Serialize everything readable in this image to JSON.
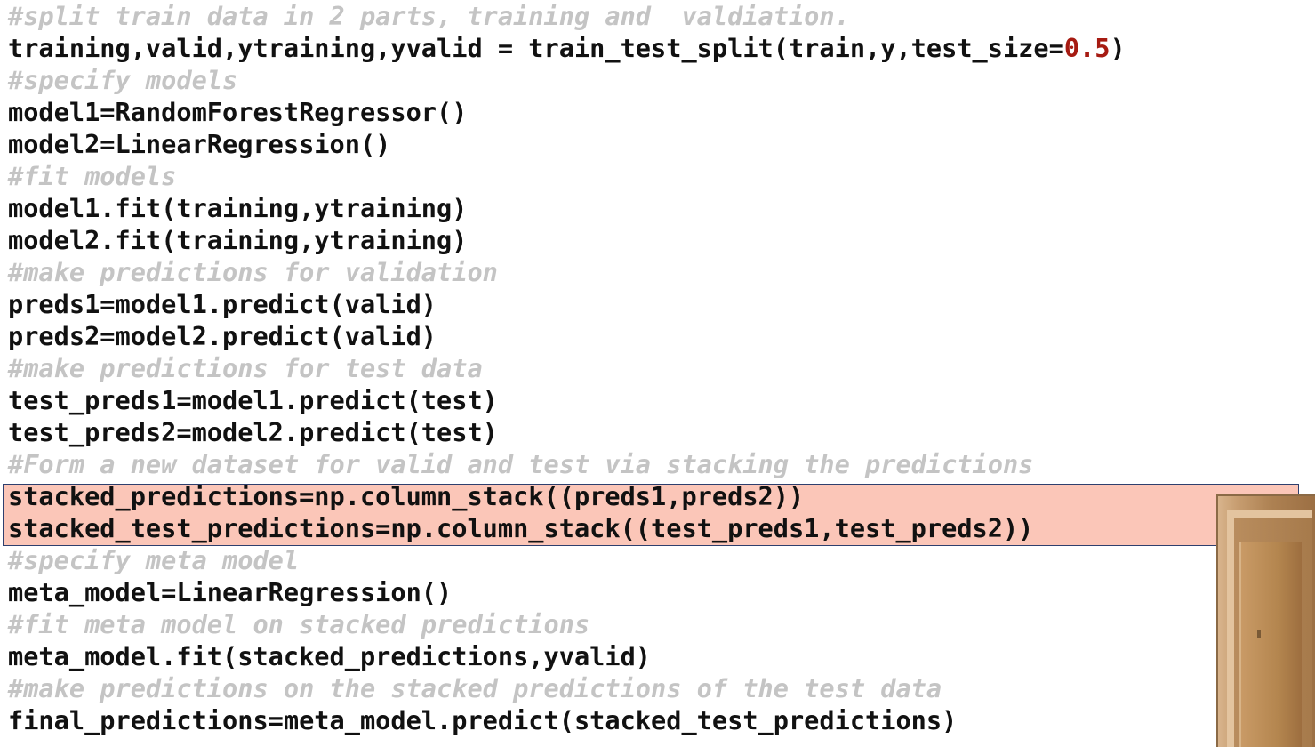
{
  "code": {
    "line_01": "#split train data in 2 parts, training and  valdiation.",
    "line_02_pre": "training,valid,ytraining,yvalid = train_test_split(train,y,test_size=",
    "line_02_num": "0.5",
    "line_02_post": ")",
    "line_03": "#specify models",
    "line_04": "model1=RandomForestRegressor()",
    "line_05": "model2=LinearRegression()",
    "line_06": "#fit models",
    "line_07": "model1.fit(training,ytraining)",
    "line_08": "model2.fit(training,ytraining)",
    "line_09": "#make predictions for validation",
    "line_10": "preds1=model1.predict(valid)",
    "line_11": "preds2=model2.predict(valid)",
    "line_12": "#make predictions for test data",
    "line_13": "test_preds1=model1.predict(test)",
    "line_14": "test_preds2=model2.predict(test)",
    "line_15": "#Form a new dataset for valid and test via stacking the predictions",
    "line_16": "stacked_predictions=np.column_stack((preds1,preds2))",
    "line_17": "stacked_test_predictions=np.column_stack((test_preds1,test_preds2))",
    "line_18": "#specify meta model",
    "line_19": "meta_model=LinearRegression()",
    "line_20": "#fit meta model on stacked predictions",
    "line_21": "meta_model.fit(stacked_predictions,yvalid)",
    "line_22": "#make predictions on the stacked predictions of the test data",
    "line_23": "final_predictions=meta_model.predict(stacked_test_predictions)"
  },
  "colors": {
    "comment": "#c4c4c4",
    "code": "#111111",
    "number": "#a61b12",
    "highlight_fill": "#fbc6b8",
    "highlight_border": "#2e3f6e"
  }
}
